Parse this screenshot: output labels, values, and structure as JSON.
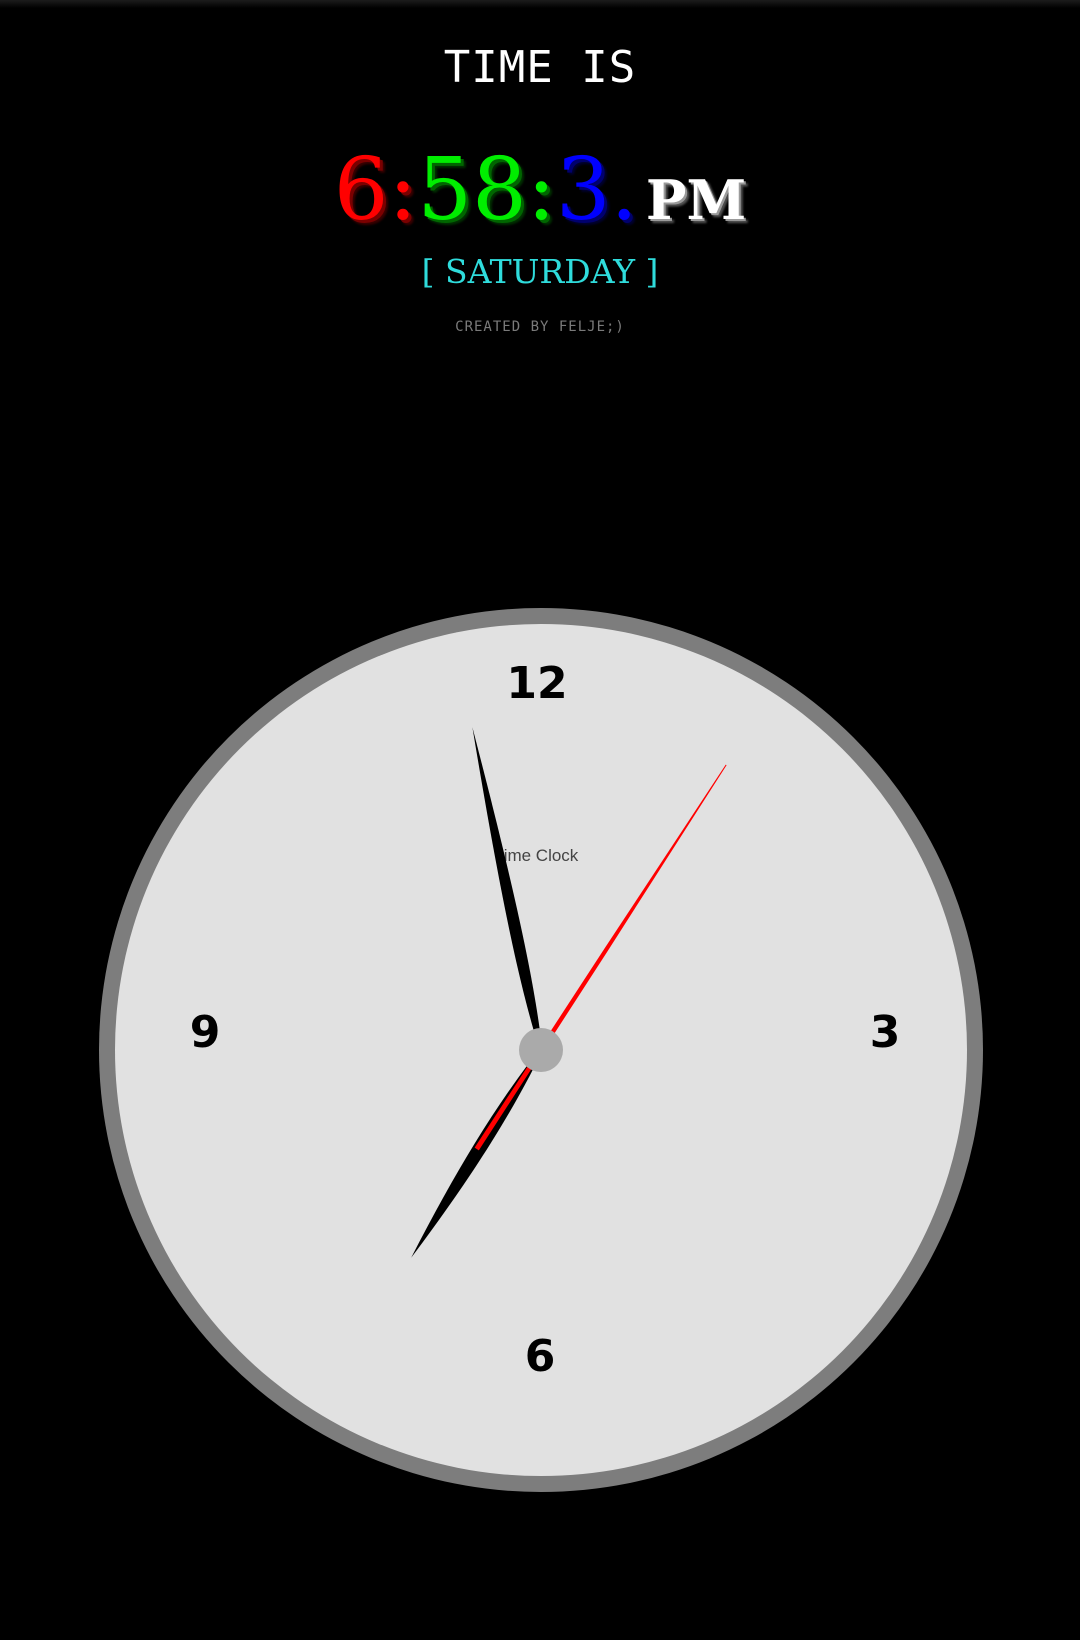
{
  "header": {
    "title": "TIME IS"
  },
  "digital_clock": {
    "hours": "6",
    "sep1": ":",
    "minutes": "58",
    "sep2": ":",
    "seconds": "3",
    "sep3": ".",
    "ampm": "PM",
    "day": "[ SATURDAY ]",
    "credit": "CREATED BY FELJE;)"
  },
  "analog_clock": {
    "label": "ime Clock",
    "numerals": {
      "twelve": "12",
      "three": "3",
      "six": "6",
      "nine": "9"
    },
    "time": {
      "hours": 6,
      "minutes": 58,
      "seconds": 3
    }
  },
  "colors": {
    "background": "#000000",
    "hours_digit": "#ff0000",
    "minutes_digit": "#00ee00",
    "seconds_digit": "#0000ff",
    "day_text": "#2fdcdc",
    "clock_bezel": "#7d7d7d",
    "clock_face": "#e1e1e1",
    "second_hand": "#ff0000",
    "hour_minute_hands": "#000000",
    "center_cap": "#aaaaaa"
  }
}
